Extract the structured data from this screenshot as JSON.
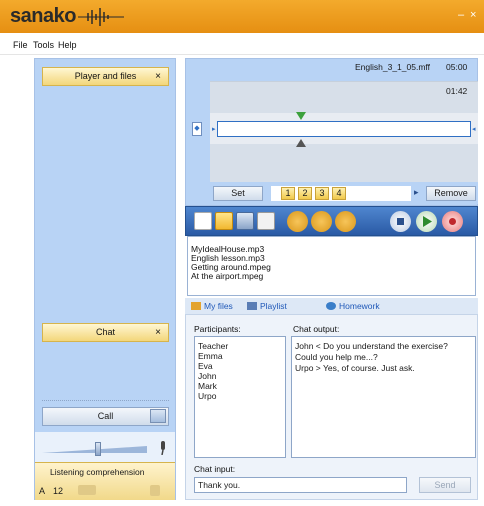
{
  "app": {
    "logo": "sanako",
    "minimize": "–",
    "close": "×"
  },
  "menu": [
    "File",
    "Tools",
    "Help"
  ],
  "left": {
    "player_tab": "Player and files",
    "chat_tab": "Chat",
    "tab_close": "×",
    "call_label": "Call",
    "volume_level": 0.55,
    "lesson_title": "Listening comprehension",
    "seat_label": "A",
    "seat_number": "12"
  },
  "player": {
    "filename": "English_3_1_05.mff",
    "duration": "05:00",
    "position": "01:42",
    "set_label": "Set",
    "remove_label": "Remove",
    "bookmarks": [
      "1",
      "2",
      "3",
      "4"
    ],
    "prev": "◂",
    "next": "▸"
  },
  "toolbar_icons": [
    "new-file-icon",
    "open-folder-icon",
    "save-icon",
    "audio-levels-icon",
    "speed-icon",
    "repeat-icon",
    "exit-icon",
    "stop-icon",
    "play-icon",
    "record-icon"
  ],
  "files": [
    "MyIdealHouse.mp3",
    "English lesson.mp3",
    "Getting around.mpeg",
    "At the airport.mpeg"
  ],
  "tabs": [
    "My files",
    "Playlist",
    "Homework"
  ],
  "chat": {
    "participants_label": "Participants:",
    "output_label": "Chat output:",
    "input_label": "Chat input:",
    "participants": [
      "Teacher",
      "Emma",
      "Eva",
      "John",
      "Mark",
      "Urpo"
    ],
    "messages": [
      "John <  Do you understand the exercise?",
      "Could you help me...?",
      "Urpo > Yes, of course. Just ask."
    ],
    "input_value": "Thank you.",
    "send_label": "Send"
  },
  "colors": {
    "accent": "#ec9a1c",
    "panel": "#b8d3f5",
    "toolbar": "#2f64b0"
  }
}
